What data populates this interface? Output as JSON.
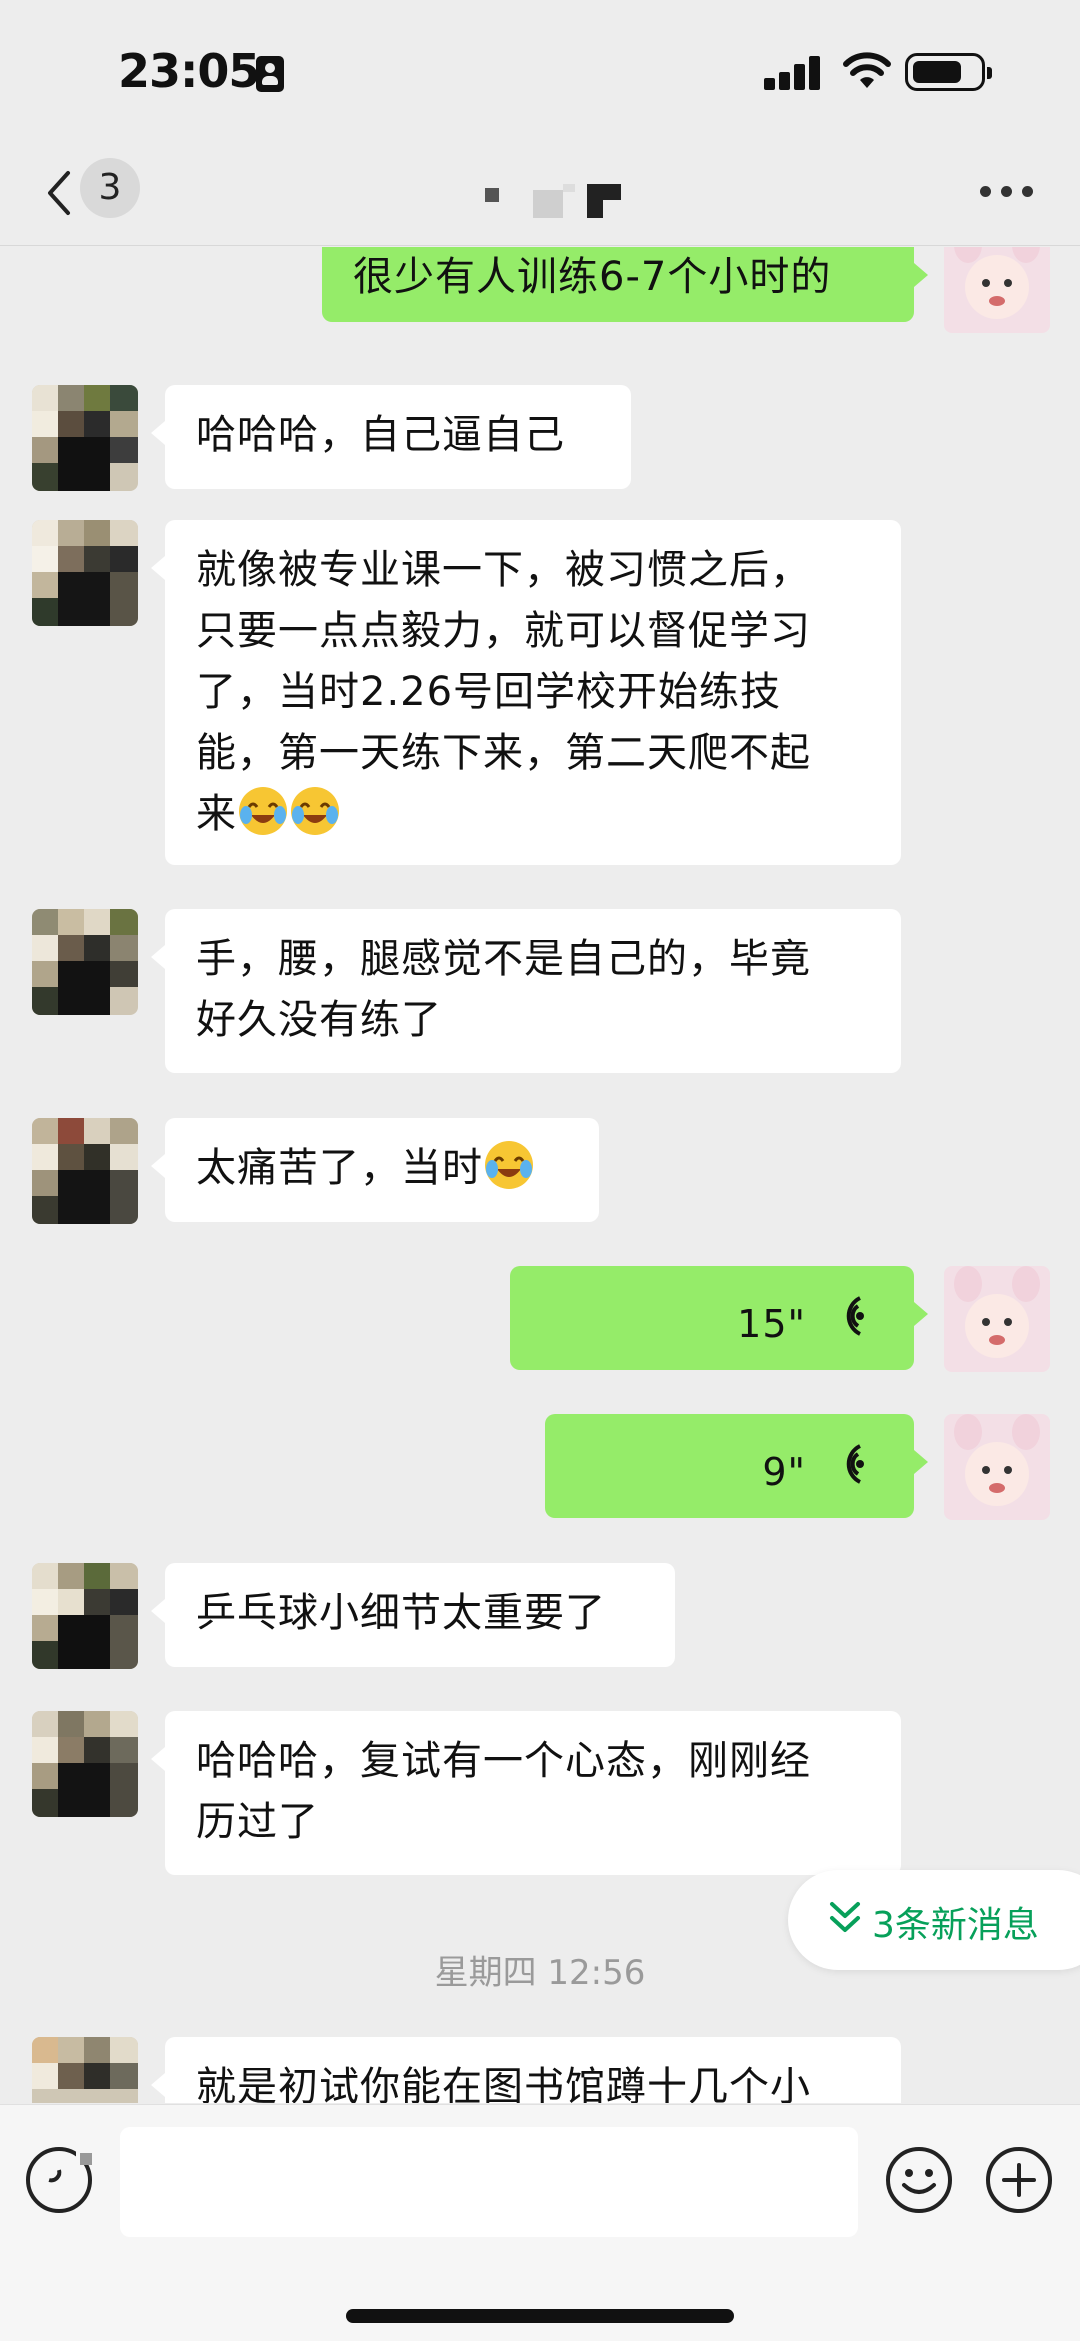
{
  "status_bar": {
    "time": "23:05"
  },
  "nav": {
    "unread_count": "3"
  },
  "messages": [
    {
      "side": "out",
      "text": "很少有人训练6-7个小时的"
    },
    {
      "side": "in",
      "text": "哈哈哈，自己逼自己"
    },
    {
      "side": "in",
      "lines": [
        "就像被专业课一下，被习惯之后，",
        "只要一点点毅力，就可以督促学习",
        "了，当时2.26号回学校开始练技",
        "能，第一天练下来，第二天爬不起",
        "来"
      ]
    },
    {
      "side": "in",
      "lines": [
        "手，腰，腿感觉不是自己的，毕竟",
        "好久没有练了"
      ]
    },
    {
      "side": "in",
      "text": "太痛苦了，当时"
    },
    {
      "side": "out",
      "type": "voice",
      "duration": "15\""
    },
    {
      "side": "out",
      "type": "voice",
      "duration": "9\""
    },
    {
      "side": "in",
      "text": "乒乓球小细节太重要了"
    },
    {
      "side": "in",
      "lines": [
        "哈哈哈，复试有一个心态，刚刚经",
        "历过了"
      ]
    },
    {
      "side": "in",
      "text": "就是初试你能在图书馆蹲十几个小"
    }
  ],
  "timestamp": "星期四 12:56",
  "new_messages": {
    "label": "3条新消息"
  },
  "emoji_names": [
    "laugh-cry-emoji"
  ],
  "colors": {
    "background": "#ededed",
    "outgoing_bubble": "#95ec69",
    "incoming_bubble": "#ffffff",
    "accent_green": "#07a05a"
  }
}
